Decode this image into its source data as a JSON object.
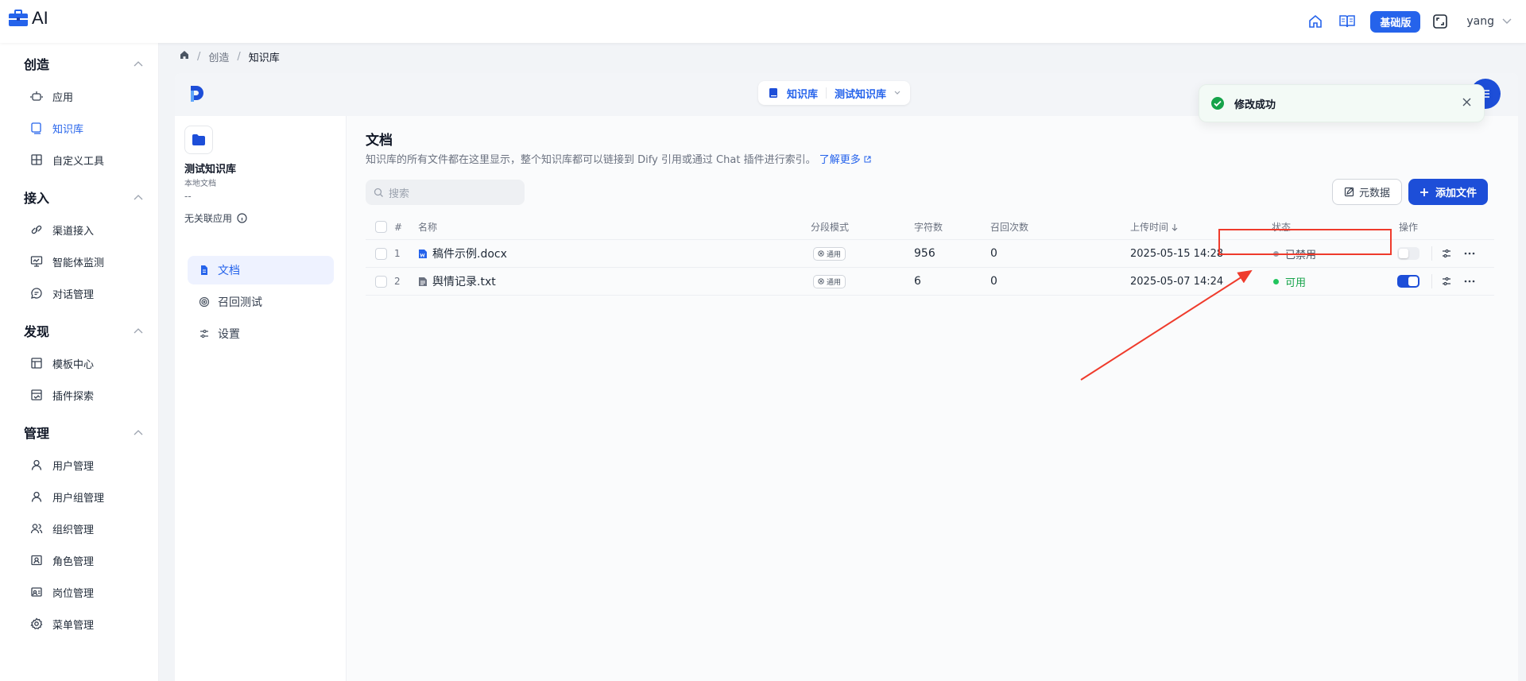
{
  "app": {
    "title": "AI",
    "tier": "基础版",
    "user": "yang"
  },
  "sidebar": {
    "groups": [
      {
        "title": "创造",
        "items": [
          "应用",
          "知识库",
          "自定义工具"
        ]
      },
      {
        "title": "接入",
        "items": [
          "渠道接入",
          "智能体监测",
          "对话管理"
        ]
      },
      {
        "title": "发现",
        "items": [
          "模板中心",
          "插件探索"
        ]
      },
      {
        "title": "管理",
        "items": [
          "用户管理",
          "用户组管理",
          "组织管理",
          "角色管理",
          "岗位管理",
          "菜单管理"
        ]
      }
    ],
    "active_item": "知识库"
  },
  "breadcrumb": {
    "home": "",
    "sep": "/",
    "level1": "创造",
    "current": "知识库"
  },
  "kb_switcher": {
    "section": "知识库",
    "name": "测试知识库"
  },
  "kb": {
    "name": "测试知识库",
    "type": "本地文档",
    "placeholder": "--",
    "linked_apps": "无关联应用",
    "menu": [
      "文档",
      "召回测试",
      "设置"
    ]
  },
  "documents": {
    "title": "文档",
    "description": "知识库的所有文件都在这里显示，整个知识库都可以链接到 Dify 引用或通过 Chat 插件进行索引。",
    "learn_more": "了解更多",
    "search_placeholder": "搜索",
    "metadata_button": "元数据",
    "add_button": "添加文件",
    "columns": [
      "#",
      "名称",
      "分段模式",
      "字符数",
      "召回次数",
      "上传时间",
      "状态",
      "操作"
    ],
    "rows": [
      {
        "index": "1",
        "name": "稿件示例.docx",
        "mode": "通用",
        "chars": "956",
        "recalls": "0",
        "uploaded": "2025-05-15 14:28",
        "status": "已禁用",
        "enabled": false
      },
      {
        "index": "2",
        "name": "舆情记录.txt",
        "mode": "通用",
        "chars": "6",
        "recalls": "0",
        "uploaded": "2025-05-07 14:24",
        "status": "可用",
        "enabled": true
      }
    ]
  },
  "toast": {
    "message": "修改成功"
  },
  "colors": {
    "accent": "#1d4ed8",
    "success": "#16a34a",
    "disabled": "#9ca3af",
    "annotation": "#ef3b2c"
  }
}
